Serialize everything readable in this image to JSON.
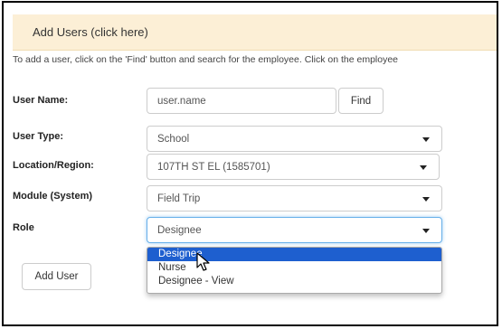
{
  "header": {
    "title": "Add Users (click here)"
  },
  "instructions": "To add a user, click on the 'Find' button and search for the employee. Click on the employee",
  "form": {
    "user_name": {
      "label": "User Name:",
      "value": "user.name",
      "find_label": "Find"
    },
    "user_type": {
      "label": "User Type:",
      "value": "School"
    },
    "location": {
      "label": "Location/Region:",
      "value": "107TH ST EL (1585701)"
    },
    "module": {
      "label": "Module (System)",
      "value": "Field Trip"
    },
    "role": {
      "label": "Role",
      "value": "Designee",
      "options": [
        "Designee",
        "Nurse",
        "Designee - View"
      ],
      "highlighted_index": 0
    },
    "add_user_label": "Add User"
  },
  "colors": {
    "header_bg": "#fcefd6",
    "highlight": "#1e5fcf"
  },
  "icons": {
    "cursor": "mouse-pointer-icon",
    "caret": "chevron-down-icon"
  }
}
